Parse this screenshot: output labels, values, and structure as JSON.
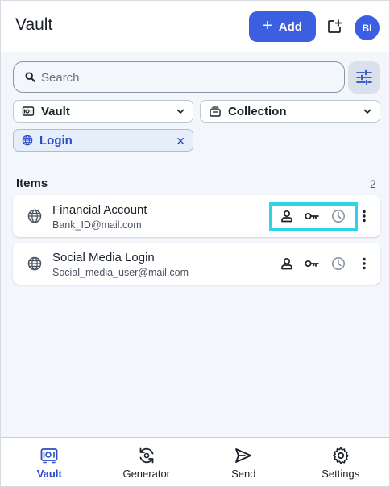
{
  "header": {
    "title": "Vault",
    "add_label": "Add",
    "avatar_initials": "BI"
  },
  "search": {
    "placeholder": "Search"
  },
  "filters": {
    "vault_label": "Vault",
    "collection_label": "Collection",
    "type_chip_label": "Login"
  },
  "items": {
    "heading": "Items",
    "count": "2",
    "list": [
      {
        "name": "Financial Account",
        "subtitle": "Bank_ID@mail.com"
      },
      {
        "name": "Social Media Login",
        "subtitle": "Social_media_user@mail.com"
      }
    ]
  },
  "nav": {
    "items": [
      {
        "label": "Vault",
        "icon": "vault-icon",
        "active": true
      },
      {
        "label": "Generator",
        "icon": "generator-icon",
        "active": false
      },
      {
        "label": "Send",
        "icon": "send-icon",
        "active": false
      },
      {
        "label": "Settings",
        "icon": "gear-icon",
        "active": false
      }
    ]
  },
  "colors": {
    "accent": "#3b5fe0",
    "highlight": "#2fd4e6",
    "chip_bg": "#e7eefb"
  }
}
